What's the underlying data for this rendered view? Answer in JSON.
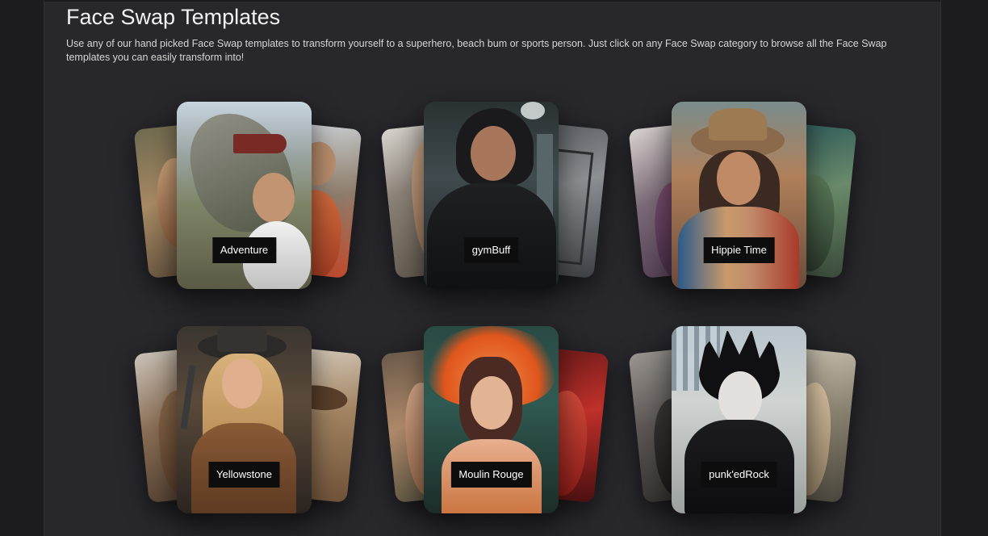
{
  "page": {
    "title": "Face Swap Templates",
    "description": "Use any of our hand picked Face Swap templates to transform yourself to a superhero, beach bum or sports person. Just click on any Face Swap category to browse all the Face Swap templates you can easily transform into!"
  },
  "templates": [
    {
      "label": "Adventure"
    },
    {
      "label": "gymBuff"
    },
    {
      "label": "Hippie Time"
    },
    {
      "label": "Yellowstone"
    },
    {
      "label": "Moulin Rouge"
    },
    {
      "label": "punk'edRock"
    }
  ],
  "colors": {
    "background": "#1c1c20",
    "panel": "#27272c",
    "label_bg": "#0d0d0d",
    "text": "#f2f2f2"
  }
}
